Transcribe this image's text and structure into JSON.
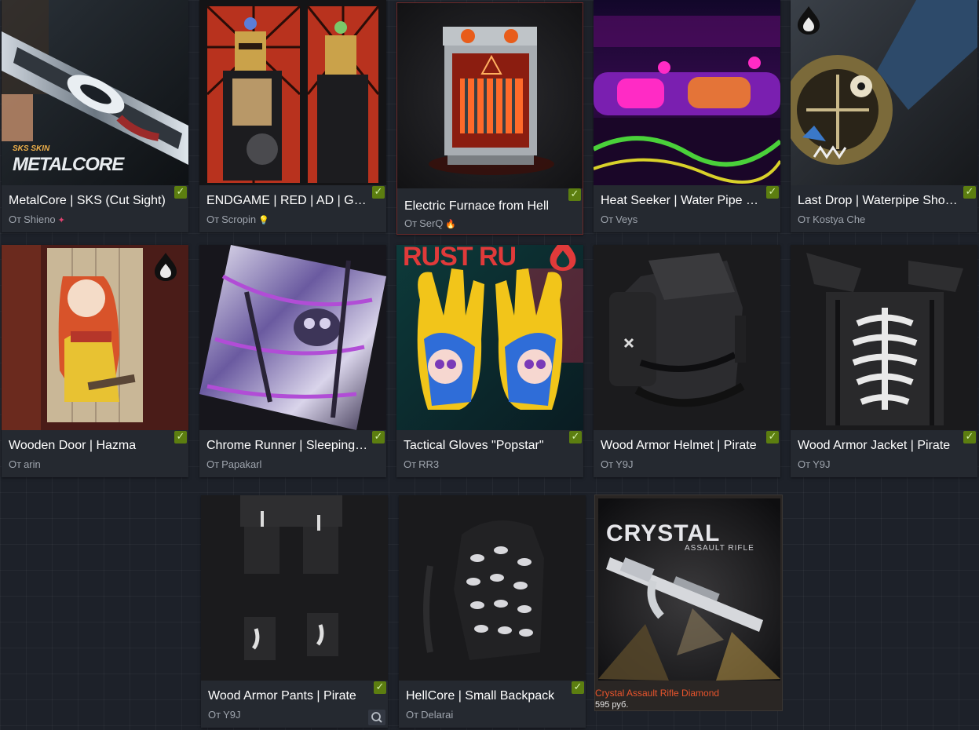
{
  "items": [
    {
      "title": "MetalCore | SKS (Cut Sight)",
      "author_prefix": "От",
      "author": "Shieno",
      "badge": "✦",
      "overlay_text": "SKS SKIN",
      "overlay_title": "METALCORE"
    },
    {
      "title": "ENDGAME | RED | AD | GL…",
      "author_prefix": "От",
      "author": "Scropin",
      "badge": "💡"
    },
    {
      "title": "Electric Furnace from Hell",
      "author_prefix": "От",
      "author": "SerQ",
      "badge": "🔥"
    },
    {
      "title": "Heat Seeker | Water Pipe …",
      "author_prefix": "От",
      "author": "Veys",
      "badge": ""
    },
    {
      "title": "Last Drop | Waterpipe Sho…",
      "author_prefix": "От",
      "author": "Kostya Che",
      "badge": ""
    },
    {
      "title": "Wooden Door | Hazma",
      "author_prefix": "От",
      "author": "arin",
      "badge": ""
    },
    {
      "title": "Chrome Runner | Sleeping…",
      "author_prefix": "От",
      "author": "Papakarl",
      "badge": ""
    },
    {
      "title": "Tactical Gloves \"Popstar\"",
      "author_prefix": "От",
      "author": "RR3",
      "badge": "",
      "overlay_text": "RUST RU"
    },
    {
      "title": "Wood Armor Helmet | Pirate",
      "author_prefix": "От",
      "author": "Y9J",
      "badge": ""
    },
    {
      "title": "Wood Armor Jacket | Pirate",
      "author_prefix": "От",
      "author": "Y9J",
      "badge": ""
    },
    {
      "title": "Wood Armor Pants | Pirate",
      "author_prefix": "От",
      "author": "Y9J",
      "badge": ""
    },
    {
      "title": "HellCore | Small Backpack",
      "author_prefix": "От",
      "author": "Delarai",
      "badge": ""
    }
  ],
  "store_item": {
    "name": "Crystal Assault Rifle Diamond",
    "price": "595 руб.",
    "overlay_title": "CRYSTAL",
    "overlay_subtitle": "ASSAULT RIFLE"
  },
  "icons": {
    "check": "checkmark-icon",
    "magnify": "magnifier-icon"
  },
  "colors": {
    "accepted": "#5c7e10",
    "store_name": "#e8542c"
  }
}
